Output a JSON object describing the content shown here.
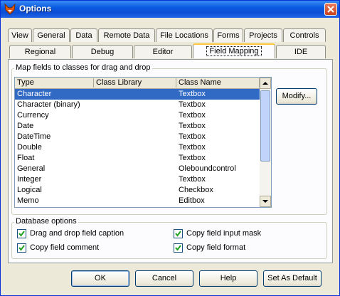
{
  "window": {
    "title": "Options"
  },
  "tabs_row1": [
    "View",
    "General",
    "Data",
    "Remote Data",
    "File Locations",
    "Forms",
    "Projects",
    "Controls"
  ],
  "tabs_row2": [
    "Regional",
    "Debug",
    "Editor",
    "Field Mapping",
    "IDE"
  ],
  "active_tab": "Field Mapping",
  "mapping": {
    "group_label": "Map fields to classes for drag and drop",
    "columns": [
      "Type",
      "Class Library",
      "Class Name"
    ],
    "rows": [
      {
        "type": "Character",
        "library": "",
        "class": "Textbox"
      },
      {
        "type": "Character (binary)",
        "library": "",
        "class": "Textbox"
      },
      {
        "type": "Currency",
        "library": "",
        "class": "Textbox"
      },
      {
        "type": "Date",
        "library": "",
        "class": "Textbox"
      },
      {
        "type": "DateTime",
        "library": "",
        "class": "Textbox"
      },
      {
        "type": "Double",
        "library": "",
        "class": "Textbox"
      },
      {
        "type": "Float",
        "library": "",
        "class": "Textbox"
      },
      {
        "type": "General",
        "library": "",
        "class": "Oleboundcontrol"
      },
      {
        "type": "Integer",
        "library": "",
        "class": "Textbox"
      },
      {
        "type": "Logical",
        "library": "",
        "class": "Checkbox"
      },
      {
        "type": "Memo",
        "library": "",
        "class": "Editbox"
      }
    ],
    "selected_row": 0,
    "modify_label": "Modify..."
  },
  "db_options": {
    "group_label": "Database options",
    "items": [
      {
        "label": "Drag and drop field caption",
        "checked": true
      },
      {
        "label": "Copy field input mask",
        "checked": true
      },
      {
        "label": "Copy field comment",
        "checked": true
      },
      {
        "label": "Copy field format",
        "checked": true
      }
    ]
  },
  "buttons": {
    "ok": "OK",
    "cancel": "Cancel",
    "help": "Help",
    "set_default": "Set As Default"
  }
}
